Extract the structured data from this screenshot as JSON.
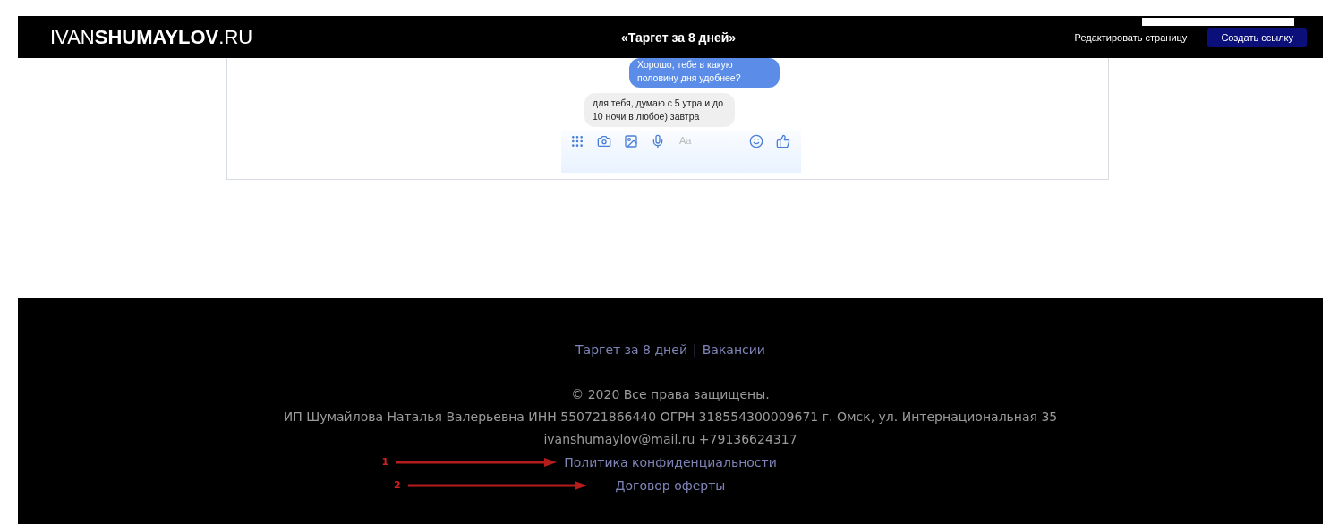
{
  "header": {
    "logo": "IVAN**SHUMAYLOV**.RU",
    "title": "«Таргет за 8 дней»",
    "buttons": [
      {
        "label": "Редактировать страницу",
        "kind": "plain"
      },
      {
        "label": "Создать ссылку",
        "kind": "primary"
      }
    ]
  },
  "chat": {
    "messages": [
      {
        "text": "Хорошо, тебе в какую половину дня удобнее?",
        "outgoing": true
      },
      {
        "text": "для тебя, думаю с 5 утра и до 10 ночи в любое) завтра",
        "outgoing": false
      }
    ],
    "composer": {
      "placeholder": "Aa"
    }
  },
  "footer": {
    "links": [
      "Таргет за 8 дней",
      "Вакансии"
    ],
    "separator": "|",
    "copyright": "© 2020 Все права защищены.",
    "legal": "ИП Шумайлова Наталья Валерьевна ИНН 550721866440 ОГРН 318554300009671 г. Омск, ул. Интернациональная 35",
    "contacts": "ivanshumaylov@mail.ru +79136624317",
    "policy_links": [
      {
        "label": "Политика конфиденциальности",
        "marker": "1"
      },
      {
        "label": "Договор оферты",
        "marker": "2"
      }
    ]
  }
}
